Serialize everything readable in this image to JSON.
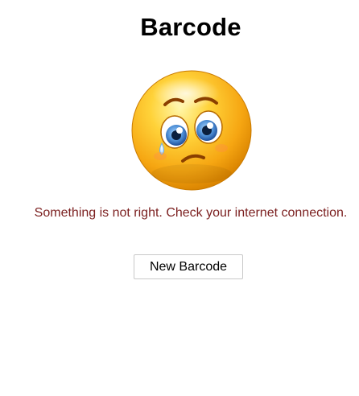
{
  "page": {
    "title": "Barcode",
    "error_message": "Something is not right. Check your internet connection.",
    "new_barcode_label": "New Barcode"
  },
  "image": {
    "icon": "sad-face-emoji-icon"
  },
  "colors": {
    "error_text": "#7b1f1f",
    "emoji_face": "#f6b21a",
    "emoji_iris": "#4e8fd6"
  }
}
